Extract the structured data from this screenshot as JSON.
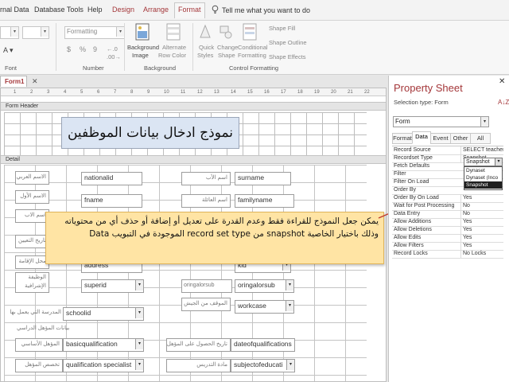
{
  "menu": {
    "tabs": [
      "rnal Data",
      "Database Tools",
      "Help",
      "Design",
      "Arrange",
      "Format"
    ],
    "tell_me": "Tell me what you want to do"
  },
  "ribbon": {
    "format_dropdown": "Formatting",
    "number_symbols": [
      "$",
      "%",
      "9"
    ],
    "decimal_buttons": [
      "←.0",
      ".00→"
    ],
    "background_image": [
      "Background",
      "Image"
    ],
    "alternate_row_color": [
      "Alternate",
      "Row Color"
    ],
    "quick_styles": [
      "Quick",
      "Styles"
    ],
    "change_shape": [
      "Change",
      "Shape"
    ],
    "conditional_formatting": [
      "Conditional",
      "Formatting"
    ],
    "shape_fill": "Shape Fill",
    "shape_outline": "Shape Outline",
    "shape_effects": "Shape Effects",
    "groups": [
      "Font",
      "Number",
      "Background",
      "Control Formatting"
    ]
  },
  "document": {
    "tab_label": "Form1",
    "ruler_ticks": [
      "1",
      "2",
      "3",
      "4",
      "5",
      "6",
      "7",
      "8",
      "9",
      "10",
      "11",
      "12",
      "13",
      "14",
      "15",
      "16",
      "17",
      "18",
      "19",
      "20",
      "21",
      "22"
    ],
    "form_header_label": "Form Header",
    "detail_label": "Detail",
    "title_text": "نموذج ادخال بيانات الموظفين",
    "labels": {
      "r1_left": "الاسم العربي",
      "r2_left": "الاسم الأول",
      "r3_left": "اسم الاب",
      "r4_left": "تاريخ التعيين",
      "r5_left": "محل الإقامة",
      "r6_left": "الوظيفة الإشرافية",
      "r1_mid": "اسم الأب",
      "r2_mid": "اسم العائلة",
      "r6_mid": "الموقف من الجيش",
      "school_label": "المدرسة التي يعمل بها",
      "section_label": "بيانات المؤهل الدراسي",
      "q1_left": "المؤهل الأساسي",
      "q2_left": "تخصص المؤهل",
      "q1_mid": "تاريخ الحصول على المؤهل",
      "q2_mid": "مادة التدريس"
    },
    "fields": {
      "nationalid": "nationalid",
      "surname": "surname",
      "fname": "fname",
      "familyname": "familyname",
      "address": "address",
      "kid": "kid",
      "superid": "superid",
      "oringalorsub_label": "oringalorsub",
      "oringalorsub": "oringalorsub",
      "workcase": "workcase",
      "schoolid": "schoolid",
      "basicqualification": "basicqualification",
      "dateofqualifications": "dateofqualifications",
      "qualification_specialist": "qualification specialist",
      "subjectofeducation": "subjectofeducati"
    },
    "callout_text": "يمكن جعل النموذج للقراءة فقط وعدم القدرة على تعديل أو إضافة أو حذف أي من محتوياته وذلك باختيار الخاصية snapshot من record set type الموجودة في التبويب Data"
  },
  "property_sheet": {
    "title": "Property Sheet",
    "selection_type": "Selection type:  Form",
    "selected_object": "Form",
    "tabs": [
      "Format",
      "Data",
      "Event",
      "Other",
      "All"
    ],
    "active_tab": "Data",
    "rows": [
      {
        "name": "Record Source",
        "value": "SELECT teachers.n"
      },
      {
        "name": "Recordset Type",
        "value": "Snapshot"
      },
      {
        "name": "Fetch Defaults",
        "value": ""
      },
      {
        "name": "Filter",
        "value": ""
      },
      {
        "name": "Filter On Load",
        "value": ""
      },
      {
        "name": "Order By",
        "value": ""
      },
      {
        "name": "Order By On Load",
        "value": "Yes"
      },
      {
        "name": "Wait for Post Processing",
        "value": "No"
      },
      {
        "name": "Data Entry",
        "value": "No"
      },
      {
        "name": "Allow Additions",
        "value": "Yes"
      },
      {
        "name": "Allow Deletions",
        "value": "Yes"
      },
      {
        "name": "Allow Edits",
        "value": "Yes"
      },
      {
        "name": "Allow Filters",
        "value": "Yes"
      },
      {
        "name": "Record Locks",
        "value": "No Locks"
      }
    ],
    "recordset_options": [
      "Dynaset",
      "Dynaset (Inco",
      "Snapshot"
    ],
    "recordset_selected": "Snapshot"
  },
  "colors": {
    "accent": "#a4373a",
    "callout_bg": "#ffe4a4",
    "title_bg": "#dbe5f3"
  },
  "icons": [
    "chevron-down-icon",
    "lightbulb-icon",
    "background-image-icon",
    "alternate-row-icon",
    "quick-styles-icon",
    "change-shape-icon",
    "conditional-formatting-icon",
    "close-icon",
    "sort-icon"
  ]
}
